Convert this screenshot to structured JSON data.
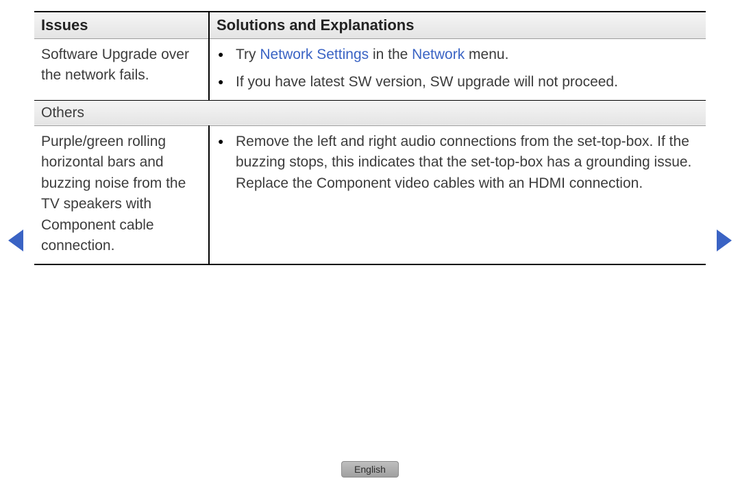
{
  "headers": {
    "issues": "Issues",
    "solutions": "Solutions and Explanations"
  },
  "row1": {
    "issue": "Software Upgrade over the network fails.",
    "bullet1_pre": "Try ",
    "bullet1_link1": "Network Settings",
    "bullet1_mid": " in the ",
    "bullet1_link2": "Network",
    "bullet1_post": " menu.",
    "bullet2": "If you have latest SW version, SW upgrade will not proceed."
  },
  "subheader": "Others",
  "row2": {
    "issue": "Purple/green rolling horizontal bars and buzzing noise from the TV speakers with Component cable connection.",
    "bullet1": "Remove the left and right audio connections from the set-top-box. If the buzzing stops, this indicates that the set-top-box has a grounding issue. Replace the Component video cables with an HDMI connection."
  },
  "language": "English"
}
